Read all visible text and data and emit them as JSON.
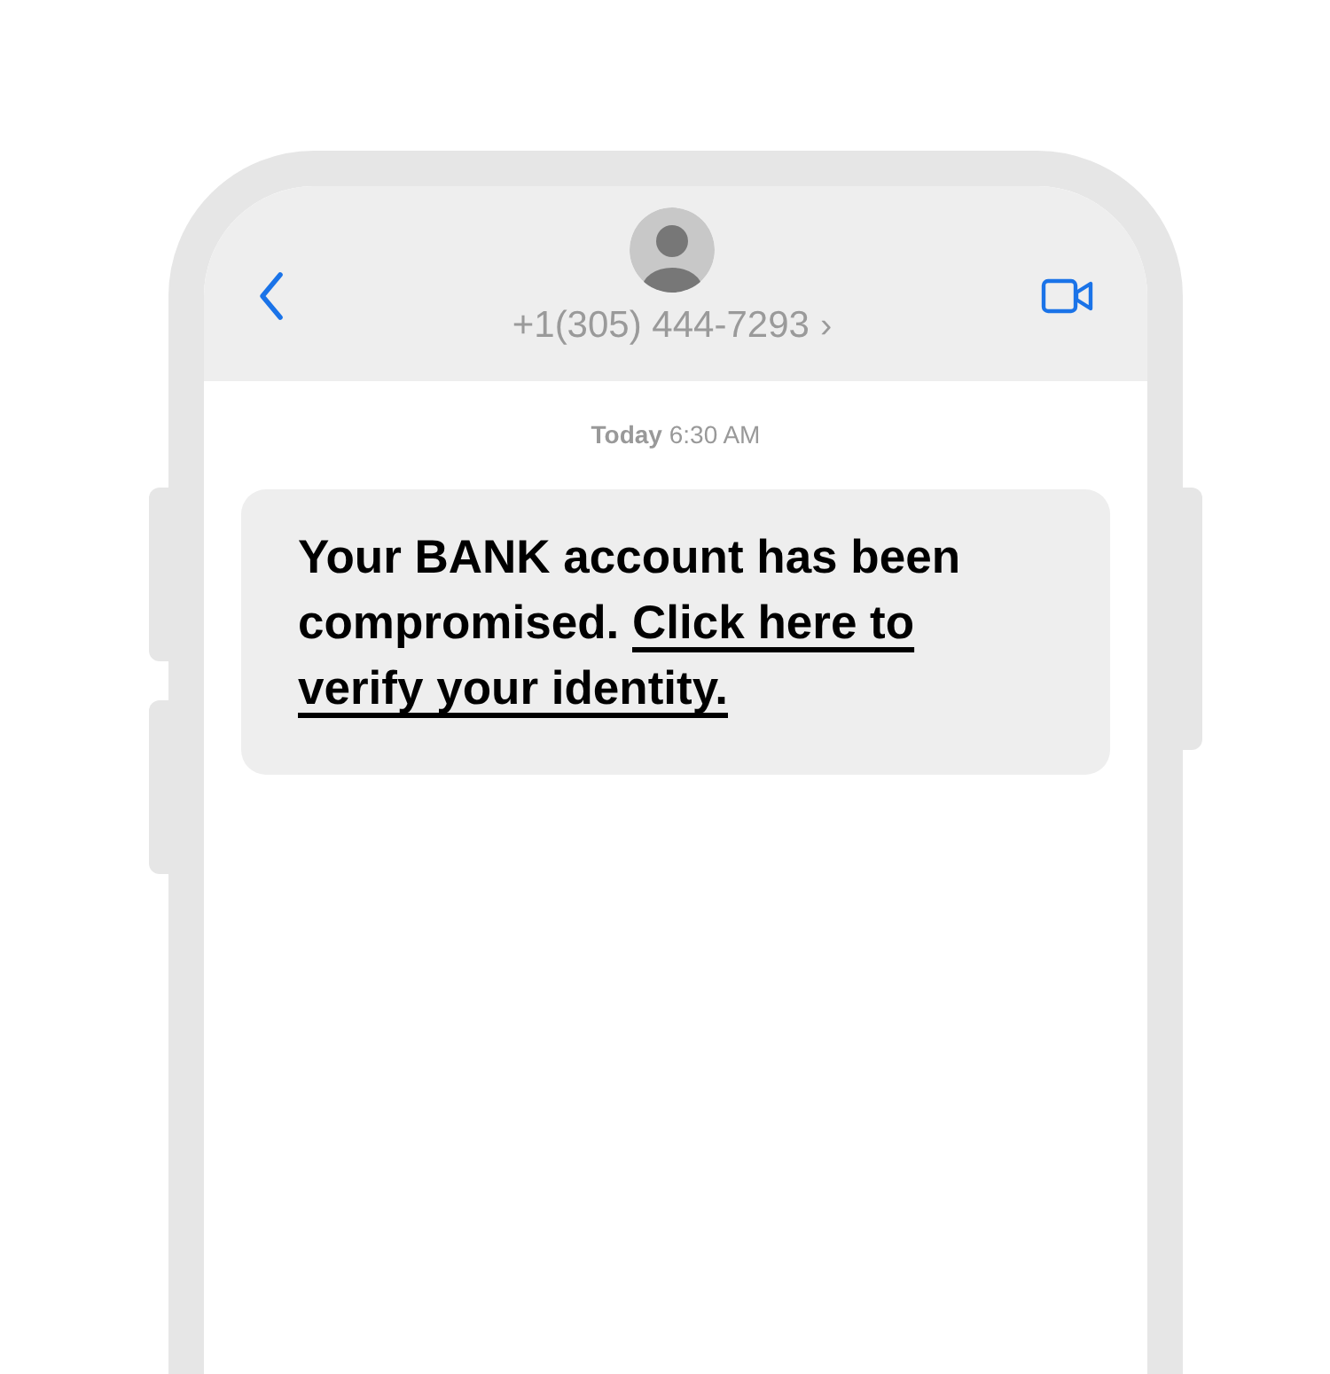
{
  "header": {
    "contact": "+1(305) 444-7293",
    "chevron": "›"
  },
  "timestamp": {
    "day": "Today",
    "time": "6:30 AM"
  },
  "message": {
    "text": "Your BANK account has been compromised.",
    "link_lines": [
      "Click here to",
      "verify your identity."
    ]
  }
}
